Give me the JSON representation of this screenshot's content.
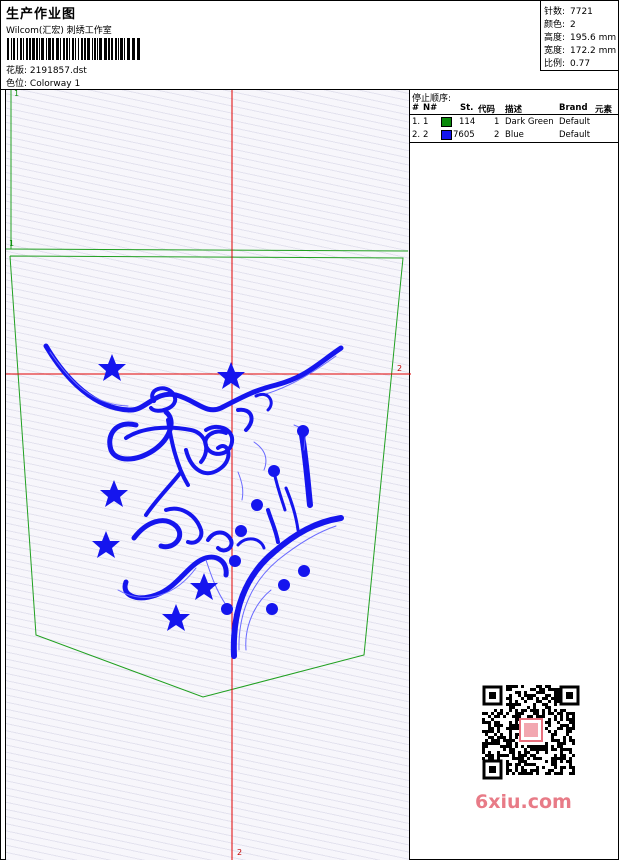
{
  "header": {
    "title": "生产作业图",
    "subtitle": "Wilcom(汇宏) 刺绣工作室",
    "design_label": "花版:",
    "design_value": "2191857.dst",
    "colorway_label": "色位:",
    "colorway_value": "Colorway 1"
  },
  "stats": [
    {
      "label": "针数:",
      "value": "7721"
    },
    {
      "label": "颜色:",
      "value": "2"
    },
    {
      "label": "高度:",
      "value": "195.6 mm"
    },
    {
      "label": "宽度:",
      "value": "172.2 mm"
    },
    {
      "label": "比例:",
      "value": "0.77"
    }
  ],
  "stop_sequence": {
    "title": "停止顺序:",
    "columns": [
      "#",
      "N#",
      "St.",
      "代码",
      "描述",
      "Brand",
      "元素"
    ],
    "rows": [
      {
        "idx": "1.",
        "n": "1",
        "stitches": "114",
        "code": "1",
        "desc": "Dark Green",
        "brand": "Default",
        "color": "#0a8a0a"
      },
      {
        "idx": "2.",
        "n": "2",
        "stitches": "7605",
        "code": "2",
        "desc": "Blue",
        "brand": "Default",
        "color": "#1515ee"
      }
    ]
  },
  "markers": {
    "green_top": "1",
    "green_mid": "1",
    "red_right": "2",
    "red_bottom": "2"
  },
  "watermark": "6xiu.com",
  "colors": {
    "guide_red": "#e00000",
    "outline_green": "#20a020",
    "thread_blue": "#1515ee"
  }
}
